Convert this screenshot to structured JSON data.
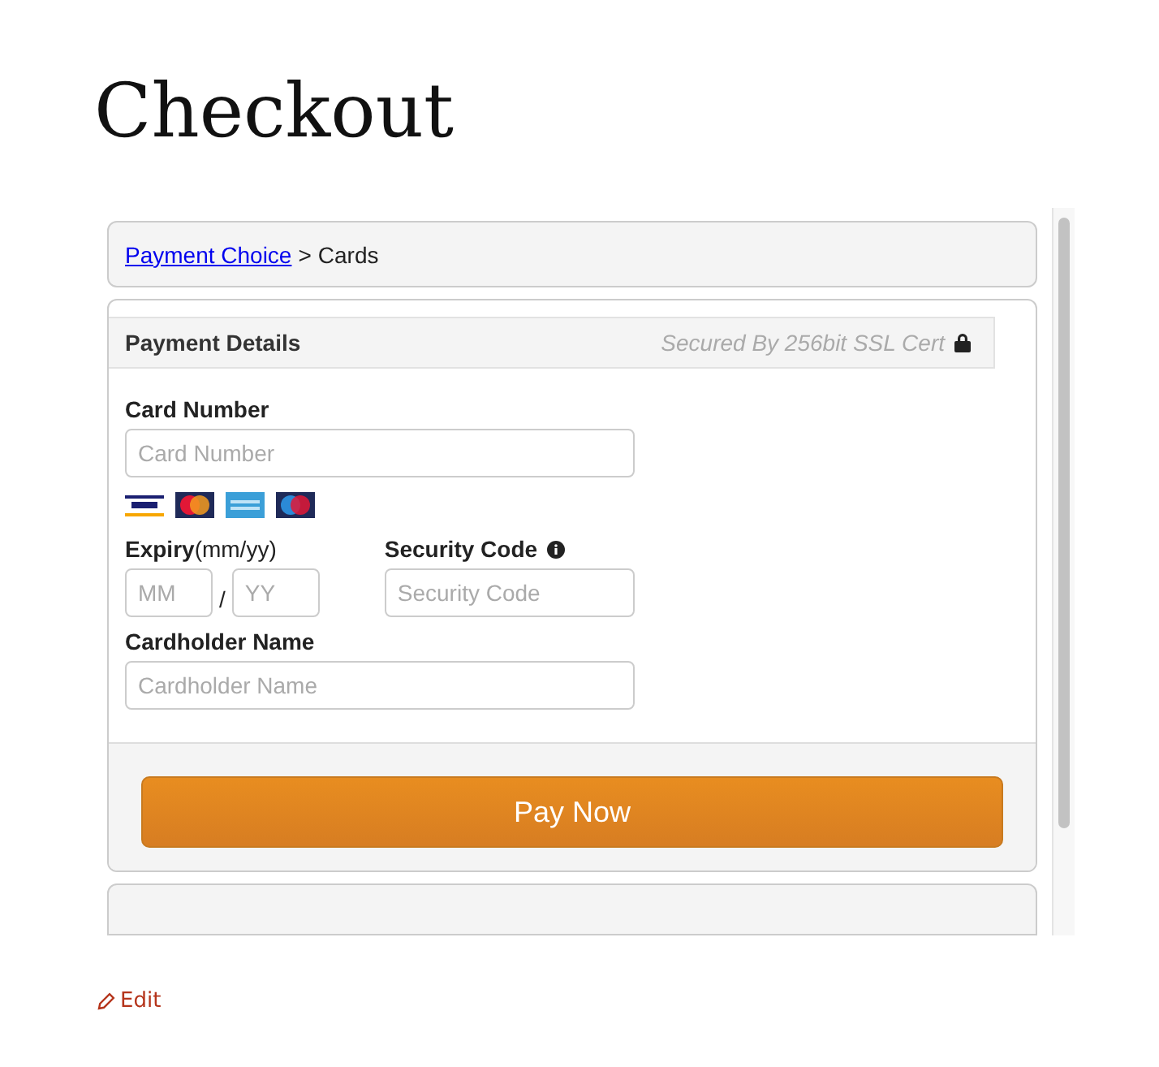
{
  "page_title": "Checkout",
  "breadcrumb": {
    "link": "Payment Choice",
    "separator": ">",
    "current": "Cards"
  },
  "payment": {
    "title": "Payment Details",
    "secure_note": "Secured By 256bit SSL Cert",
    "card_number": {
      "label": "Card Number",
      "placeholder": "Card Number"
    },
    "card_logos": [
      {
        "kind": "visa"
      },
      {
        "kind": "master"
      },
      {
        "kind": "amex"
      },
      {
        "kind": "maestro"
      }
    ],
    "expiry": {
      "label": "**Expiry**(mm/yy)",
      "month_placeholder": "MM",
      "separator": "/",
      "year_placeholder": "YY"
    },
    "security_code": {
      "label": "Security Code",
      "placeholder": "Security Code"
    },
    "cardholder": {
      "label": "Cardholder Name",
      "placeholder": "Cardholder Name"
    },
    "submit": "Pay Now"
  },
  "edit_link": "Edit"
}
